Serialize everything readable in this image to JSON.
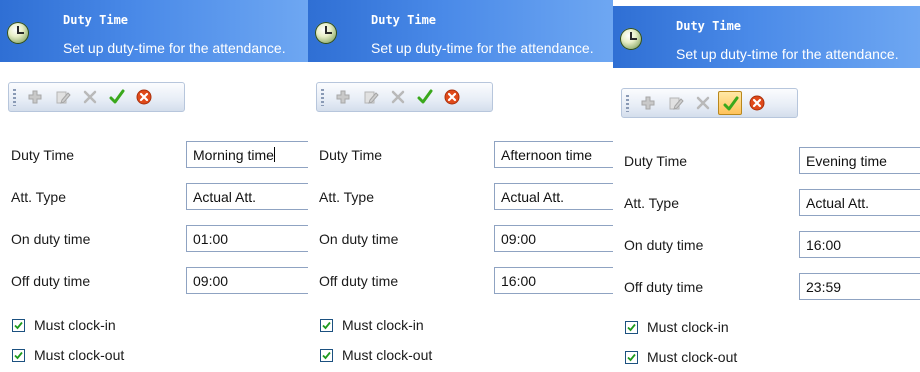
{
  "panels": [
    {
      "title": "Duty Time",
      "subtitle": "Set up duty-time for the attendance.",
      "fields": [
        {
          "label": "Duty Time",
          "value": "Morning time",
          "has_caret": true
        },
        {
          "label": "Att. Type",
          "value": "Actual Att."
        },
        {
          "label": "On duty time",
          "value": "01:00"
        },
        {
          "label": "Off duty time",
          "value": "09:00"
        }
      ],
      "checkboxes": [
        {
          "label": "Must clock-in",
          "checked": true
        },
        {
          "label": "Must clock-out",
          "checked": true
        }
      ],
      "toolbar": {
        "highlighted": ""
      }
    },
    {
      "title": "Duty Time",
      "subtitle": "Set up duty-time for the attendance.",
      "fields": [
        {
          "label": "Duty Time",
          "value": "Afternoon time"
        },
        {
          "label": "Att. Type",
          "value": "Actual Att."
        },
        {
          "label": "On duty time",
          "value": "09:00"
        },
        {
          "label": "Off duty time",
          "value": "16:00"
        }
      ],
      "checkboxes": [
        {
          "label": "Must clock-in",
          "checked": true
        },
        {
          "label": "Must clock-out",
          "checked": true
        }
      ],
      "toolbar": {
        "highlighted": ""
      }
    },
    {
      "title": "Duty Time",
      "subtitle": "Set up duty-time for the attendance.",
      "fields": [
        {
          "label": "Duty Time",
          "value": "Evening time"
        },
        {
          "label": "Att. Type",
          "value": "Actual Att."
        },
        {
          "label": "On duty time",
          "value": "16:00"
        },
        {
          "label": "Off duty time",
          "value": "23:59"
        }
      ],
      "checkboxes": [
        {
          "label": "Must clock-in",
          "checked": true
        },
        {
          "label": "Must clock-out",
          "checked": true
        }
      ],
      "toolbar": {
        "highlighted": "save"
      }
    }
  ],
  "toolbar_buttons": [
    {
      "name": "add",
      "icon": "plus-icon",
      "enabled": false
    },
    {
      "name": "edit",
      "icon": "pencil-icon",
      "enabled": false
    },
    {
      "name": "delete",
      "icon": "x-icon",
      "enabled": false
    },
    {
      "name": "save",
      "icon": "checkmark-icon",
      "enabled": true
    },
    {
      "name": "cancel",
      "icon": "cancel-icon",
      "enabled": true
    }
  ],
  "colors": {
    "header": "#2f6fd4",
    "toolbar_border": "#b7c6dc",
    "save_green": "#3aa81c",
    "cancel_red": "#e04a1a",
    "highlight": "#ffc25a"
  }
}
